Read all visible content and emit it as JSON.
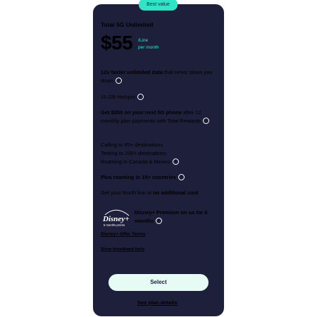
{
  "badge": "Best value",
  "plan": {
    "title": "Total 5G Unlimited",
    "price": "$55",
    "per_line": "/Line",
    "per_month": "per month"
  },
  "features": {
    "f1_bold": "12x faster unlimited data",
    "f1_rest": " that never slows you down",
    "f2": "15 GB Hotspot",
    "f3_bold": "Get $200 on your next 5G phone",
    "f3_rest": " after 12 monthly plan payments with Total Rewards",
    "f4_line1": "Calling to 85+ destinations",
    "f4_line2": "Texting to 200+ destinations",
    "f4_line3": "Roaming in Canada & Mexico",
    "f5_bold": "Plus roaming in 15+ countries",
    "f6_pre": "Get your fourth line at ",
    "f6_bold": "no additional cost"
  },
  "disney": {
    "logo_text": "Disney+",
    "logo_sub": "6 months promo",
    "offer": "Disney+ Premium on us for 6 months"
  },
  "links": {
    "offer_terms": "Disney+ Offer Terms",
    "broadband": "Show broadband facts",
    "plan_details": "See plan details"
  },
  "cta": {
    "select": "Select"
  },
  "info_glyph": "i",
  "colors": {
    "card_bg": "#1d1f3b",
    "accent": "#2ee6c6",
    "button_bg": "#e6fbf3"
  }
}
